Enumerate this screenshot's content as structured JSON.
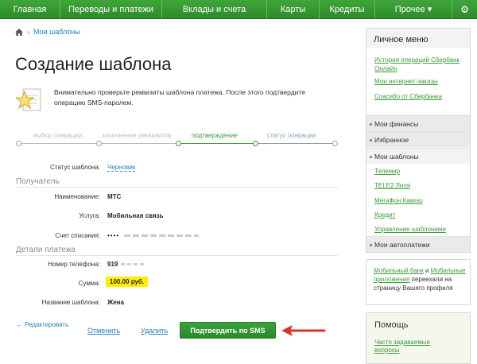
{
  "nav": {
    "items": [
      "Главная",
      "Переводы и платежи",
      "Вклады и счета",
      "Карты",
      "Кредиты",
      "Прочее ▾"
    ],
    "settings_icon": "gear-icon"
  },
  "breadcrumb": {
    "home_icon": "home-icon",
    "label": "Мои шаблоны"
  },
  "page": {
    "title": "Создание шаблона"
  },
  "notice": {
    "icon": "star-document-icon",
    "text": "Внимательно проверьте реквизиты шаблона платежа. После этого подтвердите операцию SMS-паролем."
  },
  "steps": {
    "items": [
      "выбор операции",
      "заполнение реквизитов",
      "подтверждение",
      "статус операции"
    ],
    "current_index": 2
  },
  "template_status": {
    "label": "Статус шаблона:",
    "value": "Черновик"
  },
  "recipient": {
    "title": "Получатель",
    "name_label": "Наименование:",
    "name_value": "МТС",
    "service_label": "Услуга:",
    "service_value": "Мобильная связь",
    "account_label": "Счет списания:",
    "account_value": "•••• "
  },
  "payment": {
    "title": "Детали платежа",
    "phone_label": "Номер телефона:",
    "phone_value": "919",
    "amount_label": "Сумма:",
    "amount_value": "100.00 руб.",
    "template_name_label": "Название шаблона:",
    "template_name_value": "Жена"
  },
  "actions": {
    "edit": "Редактировать",
    "cancel": "Отменить",
    "delete": "Удалить",
    "confirm_sms": "Подтвердить по SMS"
  },
  "sidebar": {
    "menu_title": "Личное меню",
    "links": [
      "История операций Сбербанк Онлайн",
      "Мои интернет-заказы",
      "Спасибо от Сбербанка"
    ],
    "sections": [
      "Мои финансы",
      "Избранное",
      "Мои шаблоны"
    ],
    "templates": [
      "Телемир",
      "TELE2 Липя",
      "МегаФон Кавказ",
      "Кредит",
      "Управление шаблонами"
    ],
    "autopay": "Мои автоплатежи",
    "mobile_parts": {
      "link1": "Мобильный банк",
      "and": " и ",
      "link2": "Мобильные приложения",
      "rest": " переехали на страницу Вашего профиля"
    },
    "help_title": "Помощь",
    "help_link": "Часто задаваемые вопросы"
  },
  "colors": {
    "brand_green": "#2e8b2a",
    "link_blue": "#2c7fb8",
    "highlight": "#ffee00",
    "arrow_red": "#d9342b"
  }
}
